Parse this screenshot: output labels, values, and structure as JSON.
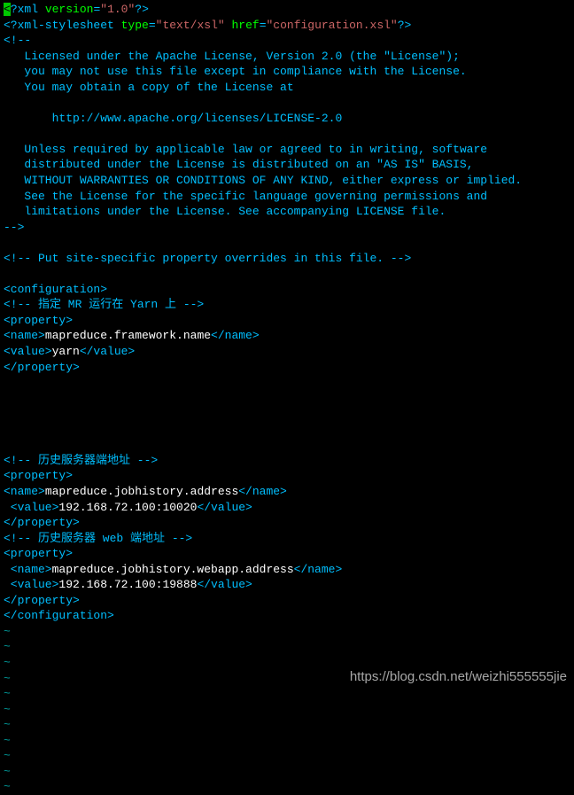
{
  "xml_decl": {
    "lead": "<",
    "q": "?",
    "tag": "xml",
    "version_attr": " version",
    "version_val": "\"1.0\"",
    "tail": "?>"
  },
  "stylesheet": {
    "lead": "<?",
    "tag": "xml-stylesheet",
    "type_attr": " type",
    "type_val": "\"text/xsl\"",
    "href_attr": " href",
    "href_val": "\"configuration.xsl\"",
    "tail": "?>"
  },
  "license_open": "<!--",
  "license_lines": [
    "   Licensed under the Apache License, Version 2.0 (the \"License\");",
    "   you may not use this file except in compliance with the License.",
    "   You may obtain a copy of the License at",
    "",
    "       http://www.apache.org/licenses/LICENSE-2.0",
    "",
    "   Unless required by applicable law or agreed to in writing, software",
    "   distributed under the License is distributed on an \"AS IS\" BASIS,",
    "   WITHOUT WARRANTIES OR CONDITIONS OF ANY KIND, either express or implied.",
    "   See the License for the specific language governing permissions and",
    "   limitations under the License. See accompanying LICENSE file."
  ],
  "license_close": "-->",
  "sitecomment": "<!-- Put site-specific property overrides in this file. -->",
  "cfg_open": "<configuration>",
  "comment1": "<!-- 指定 MR 运行在 Yarn 上 -->",
  "prop1": {
    "open": "<property>",
    "name_o": "<name>",
    "name_v": "mapreduce.framework.name",
    "name_c": "</name>",
    "value_o": "<value>",
    "value_v": "yarn",
    "value_c": "</value>",
    "close": "</property>"
  },
  "comment2": "<!-- 历史服务器端地址 -->",
  "prop2": {
    "open": "<property>",
    "name_o": "<name>",
    "name_v": "mapreduce.jobhistory.address",
    "name_c": "</name>",
    "value_o": " <value>",
    "value_v": "192.168.72.100:10020",
    "value_c": "</value>",
    "close": "</property>"
  },
  "comment3": "<!-- 历史服务器 web 端地址 -->",
  "prop3": {
    "open": "<property>",
    "name_o": " <name>",
    "name_v": "mapreduce.jobhistory.webapp.address",
    "name_c": "</name>",
    "value_o": " <value>",
    "value_v": "192.168.72.100:19888",
    "value_c": "</value>",
    "close": "</property>"
  },
  "cfg_close": "</configuration>",
  "tilde": "~",
  "tilde_count": 11,
  "watermark": "https://blog.csdn.net/weizhi555555jie"
}
